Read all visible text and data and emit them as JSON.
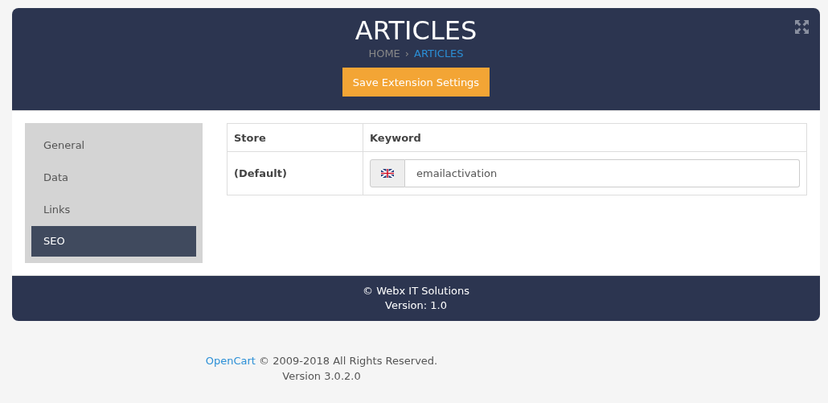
{
  "header": {
    "title": "ARTICLES",
    "breadcrumb": [
      {
        "label": "HOME",
        "current": false
      },
      {
        "label": "ARTICLES",
        "current": true
      }
    ],
    "separator": "›",
    "save_button": "Save Extension Settings"
  },
  "tabs": [
    {
      "label": "General",
      "selected": false
    },
    {
      "label": "Data",
      "selected": false
    },
    {
      "label": "Links",
      "selected": false
    },
    {
      "label": "SEO",
      "selected": true
    }
  ],
  "table": {
    "columns": [
      "Store",
      "Keyword"
    ],
    "rows": [
      {
        "store": "(Default)",
        "keyword": "emailactivation"
      }
    ]
  },
  "panel_footer": {
    "copyright": "© Webx IT Solutions",
    "version": "Version: 1.0"
  },
  "page_footer": {
    "link": "OpenCart",
    "text": " © 2009-2018 All Rights Reserved.",
    "version": "Version 3.0.2.0"
  }
}
